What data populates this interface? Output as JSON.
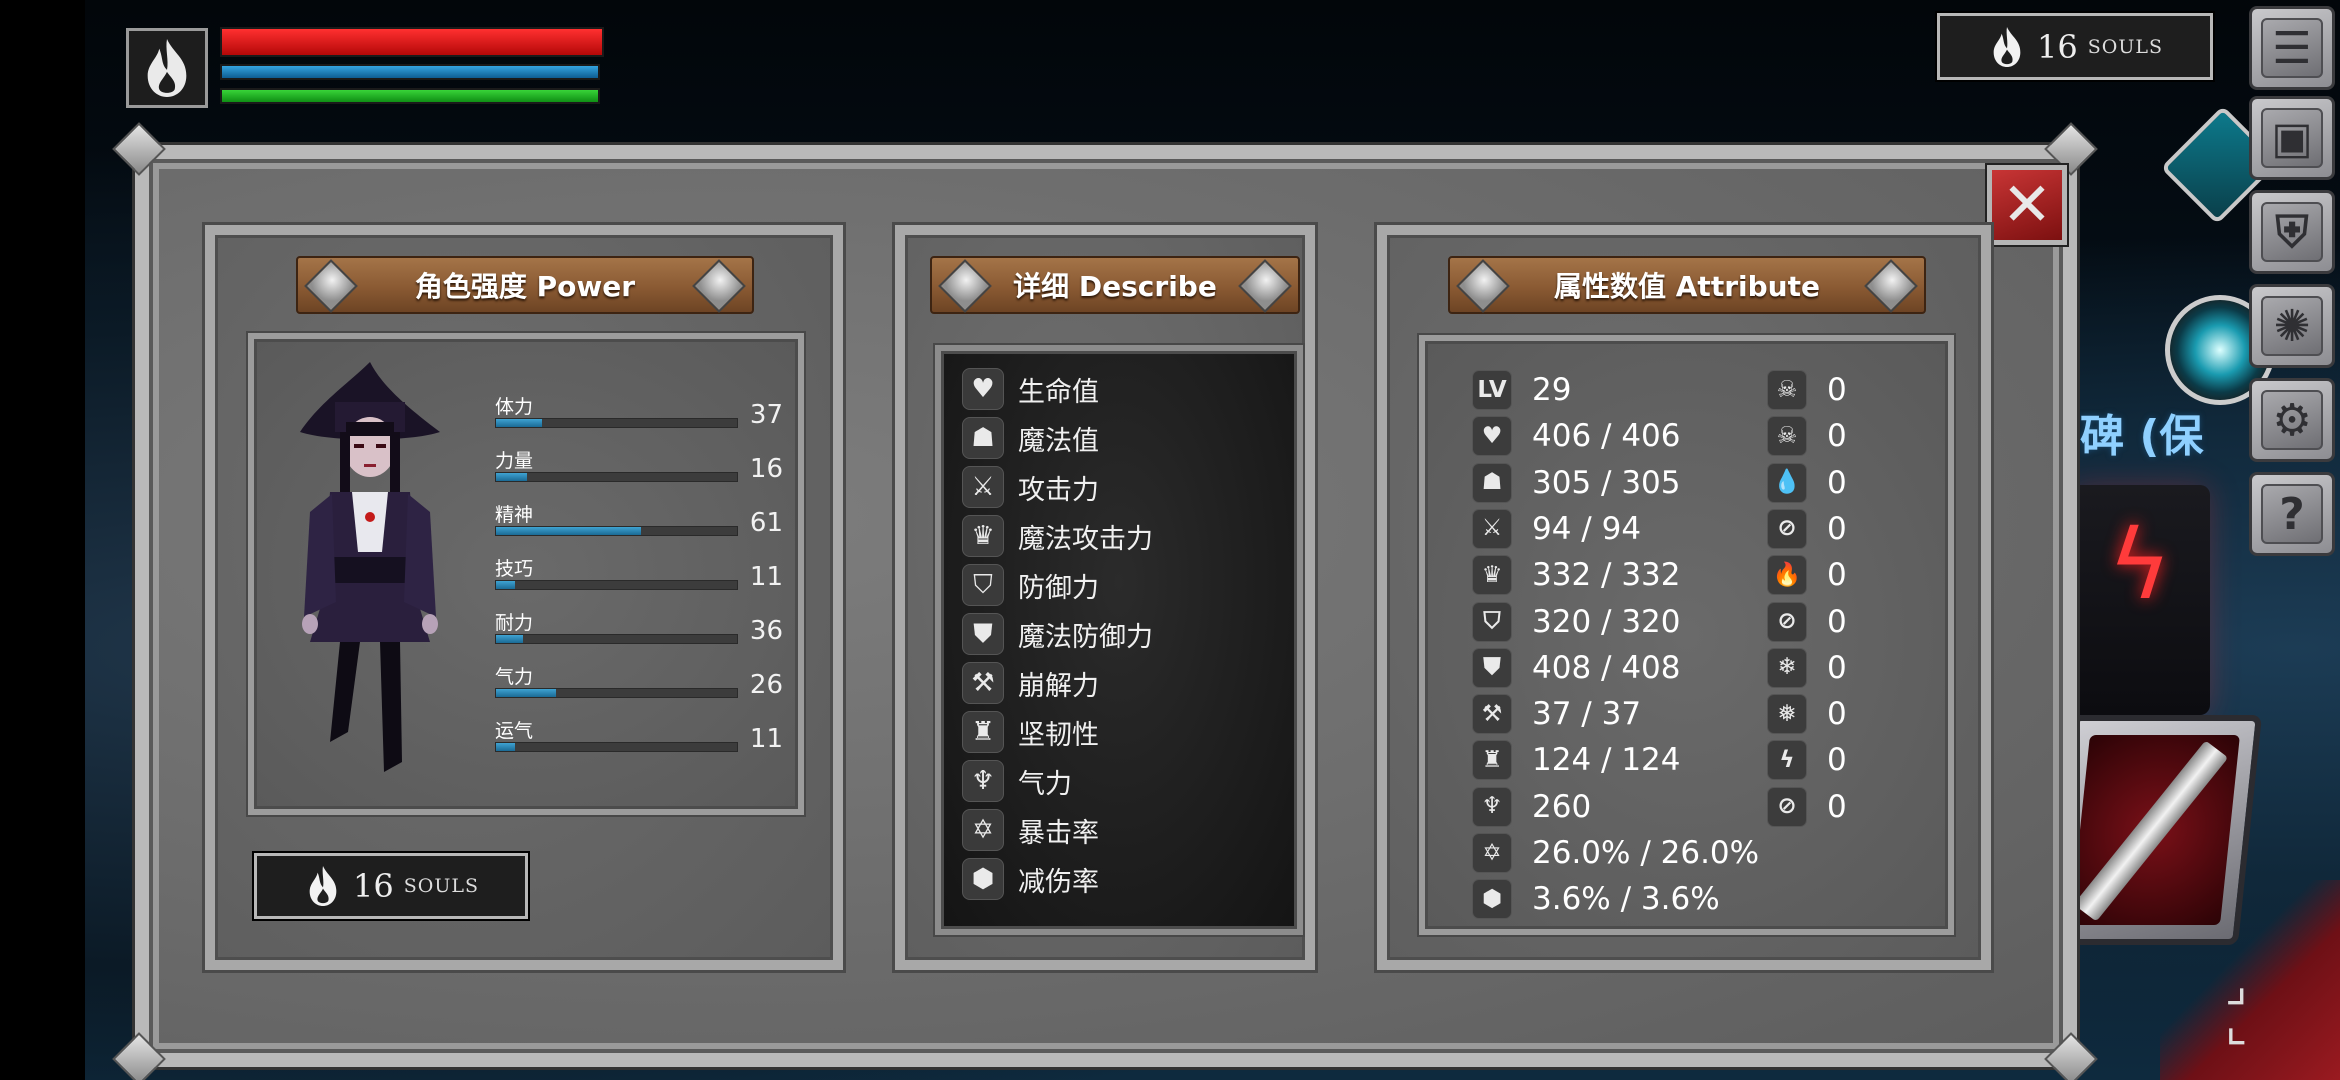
{
  "hud": {
    "souls_count": "16",
    "souls_unit": "SOULS"
  },
  "npc_label": "碑 (保",
  "panel": {
    "power": {
      "title": "角色强度 Power",
      "stats": [
        {
          "label": "体力",
          "value": "37",
          "fill": 0.19
        },
        {
          "label": "力量",
          "value": "16",
          "fill": 0.13
        },
        {
          "label": "精神",
          "value": "61",
          "fill": 0.6
        },
        {
          "label": "技巧",
          "value": "11",
          "fill": 0.08
        },
        {
          "label": "耐力",
          "value": "36",
          "fill": 0.11
        },
        {
          "label": "气力",
          "value": "26",
          "fill": 0.25
        },
        {
          "label": "运气",
          "value": "11",
          "fill": 0.08
        }
      ],
      "souls_count": "16",
      "souls_unit": "SOULS"
    },
    "describe": {
      "title": "详细 Describe",
      "items": [
        {
          "icon": "heart-icon",
          "glyph": "♥",
          "label": "生命值"
        },
        {
          "icon": "head-icon",
          "glyph": "☗",
          "label": "魔法值"
        },
        {
          "icon": "sword-icon",
          "glyph": "⚔",
          "label": "攻击力"
        },
        {
          "icon": "magic-attack-icon",
          "glyph": "♛",
          "label": "魔法攻击力"
        },
        {
          "icon": "shield-icon",
          "glyph": "⛉",
          "label": "防御力"
        },
        {
          "icon": "magic-shield-icon",
          "glyph": "⛊",
          "label": "魔法防御力"
        },
        {
          "icon": "break-icon",
          "glyph": "⚒",
          "label": "崩解力"
        },
        {
          "icon": "helmet-icon",
          "glyph": "♜",
          "label": "坚韧性"
        },
        {
          "icon": "lungs-icon",
          "glyph": "♆",
          "label": "气力"
        },
        {
          "icon": "crit-icon",
          "glyph": "✡",
          "label": "暴击率"
        },
        {
          "icon": "reduce-icon",
          "glyph": "⬢",
          "label": "减伤率"
        }
      ]
    },
    "attribute": {
      "title": "属性数值 Attribute",
      "left": [
        {
          "icon": "level-icon",
          "glyph": "LV",
          "value": "29"
        },
        {
          "icon": "heart-icon",
          "glyph": "♥",
          "value": "406 / 406"
        },
        {
          "icon": "head-icon",
          "glyph": "☗",
          "value": "305 / 305"
        },
        {
          "icon": "sword-icon",
          "glyph": "⚔",
          "value": "94 / 94"
        },
        {
          "icon": "magic-attack-icon",
          "glyph": "♛",
          "value": "332 / 332"
        },
        {
          "icon": "shield-icon",
          "glyph": "⛉",
          "value": "320 / 320"
        },
        {
          "icon": "magic-shield-icon",
          "glyph": "⛊",
          "value": "408 / 408"
        },
        {
          "icon": "break-icon",
          "glyph": "⚒",
          "value": "37 / 37"
        },
        {
          "icon": "helmet-icon",
          "glyph": "♜",
          "value": "124 / 124"
        },
        {
          "icon": "lungs-icon",
          "glyph": "♆",
          "value": "260"
        },
        {
          "icon": "crit-icon",
          "glyph": "✡",
          "value": "26.0% / 26.0%"
        },
        {
          "icon": "reduce-icon",
          "glyph": "⬢",
          "value": "3.6% / 3.6%"
        }
      ],
      "right": [
        {
          "icon": "skull-icon",
          "glyph": "☠",
          "value": "0"
        },
        {
          "icon": "skull-crossed-icon",
          "glyph": "☠",
          "value": "0"
        },
        {
          "icon": "drop-icon",
          "glyph": "💧",
          "value": "0"
        },
        {
          "icon": "drop-crossed-icon",
          "glyph": "⊘",
          "value": "0"
        },
        {
          "icon": "fire-icon",
          "glyph": "🔥",
          "value": "0"
        },
        {
          "icon": "fire-crossed-icon",
          "glyph": "⊘",
          "value": "0"
        },
        {
          "icon": "snowflake-icon",
          "glyph": "❄",
          "value": "0"
        },
        {
          "icon": "snowflake-crossed-icon",
          "glyph": "❅",
          "value": "0"
        },
        {
          "icon": "lightning-icon",
          "glyph": "ϟ",
          "value": "0"
        },
        {
          "icon": "lightning-crossed-icon",
          "glyph": "⊘",
          "value": "0"
        }
      ]
    }
  },
  "menu": [
    {
      "icon": "menu-list-icon",
      "glyph": "☰"
    },
    {
      "icon": "inventory-icon",
      "glyph": "▣"
    },
    {
      "icon": "equipment-icon",
      "glyph": "⛨"
    },
    {
      "icon": "skill-icon",
      "glyph": "✺"
    },
    {
      "icon": "settings-gear-icon",
      "glyph": "⚙"
    },
    {
      "icon": "help-icon",
      "glyph": "?"
    }
  ],
  "colors": {
    "hp": "#e81d1d",
    "mp": "#1e84c4",
    "stamina": "#1fb21f",
    "plank": "#8a5a33",
    "close": "#a82020"
  }
}
